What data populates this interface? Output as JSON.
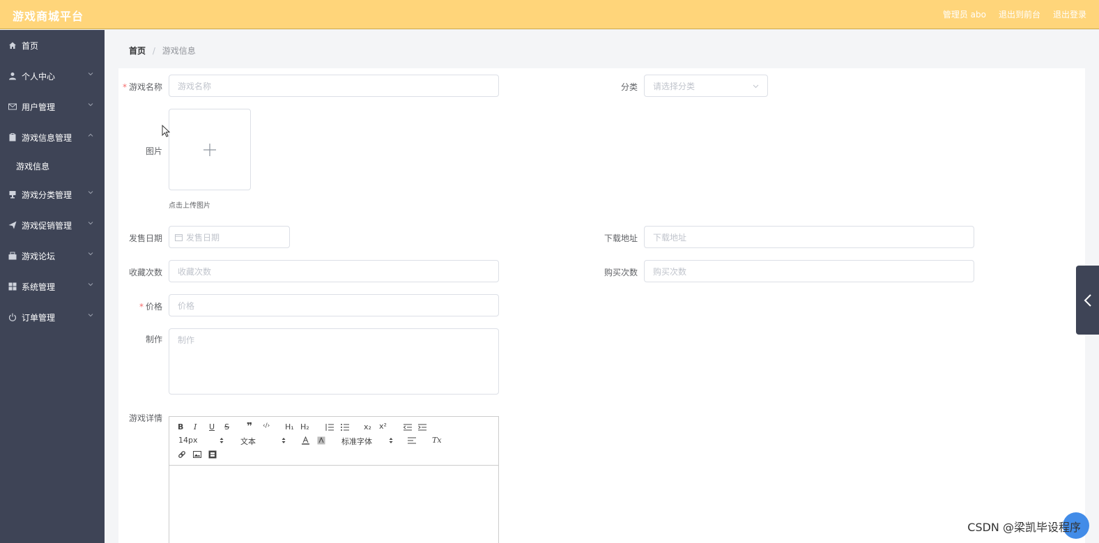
{
  "header": {
    "brand": "游戏商城平台",
    "admin": "管理员 abo",
    "back_to_front": "退出到前台",
    "logout": "退出登录"
  },
  "sidebar": {
    "items": [
      {
        "label": "首页",
        "icon": "home-icon"
      },
      {
        "label": "个人中心",
        "icon": "user-icon"
      },
      {
        "label": "用户管理",
        "icon": "mail-icon"
      },
      {
        "label": "游戏信息管理",
        "icon": "clipboard-icon",
        "expanded": true
      },
      {
        "label": "游戏分类管理",
        "icon": "cup-icon"
      },
      {
        "label": "游戏促销管理",
        "icon": "send-icon"
      },
      {
        "label": "游戏论坛",
        "icon": "box-icon"
      },
      {
        "label": "系统管理",
        "icon": "grid-icon"
      },
      {
        "label": "订单管理",
        "icon": "power-icon"
      }
    ],
    "subitem": "游戏信息"
  },
  "breadcrumb": {
    "home": "首页",
    "sep": "/",
    "current": "游戏信息"
  },
  "form": {
    "name_label": "游戏名称",
    "name_placeholder": "游戏名称",
    "category_label": "分类",
    "category_placeholder": "请选择分类",
    "image_label": "图片",
    "upload_tip": "点击上传图片",
    "release_label": "发售日期",
    "release_placeholder": "发售日期",
    "download_label": "下载地址",
    "download_placeholder": "下载地址",
    "fav_label": "收藏次数",
    "fav_placeholder": "收藏次数",
    "buy_label": "购买次数",
    "buy_placeholder": "购买次数",
    "price_label": "价格",
    "price_placeholder": "价格",
    "maker_label": "制作",
    "maker_placeholder": "制作",
    "detail_label": "游戏详情",
    "required_mark": "*"
  },
  "editor": {
    "bold": "B",
    "italic": "I",
    "underline": "U",
    "strike": "S",
    "quote": "❞",
    "code": "‹/›",
    "h1": "H₁",
    "h2": "H₂",
    "sub": "x₂",
    "sup": "x²",
    "font_size": "14px",
    "header_select": "文本",
    "font_family": "标准字体",
    "clean": "Tx"
  },
  "watermark": "CSDN @梁凯毕设程序"
}
